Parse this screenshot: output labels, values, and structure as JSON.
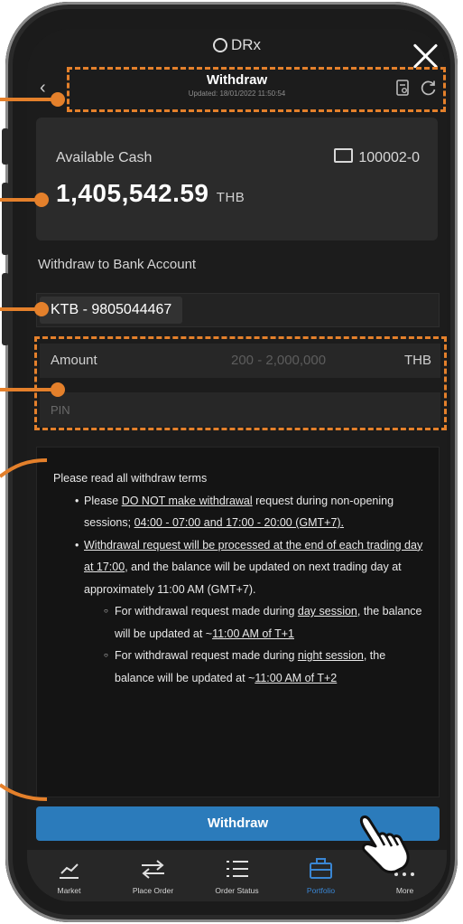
{
  "app": {
    "brand": "DRx"
  },
  "header": {
    "back_icon": "chevron-left-icon",
    "title": "Withdraw",
    "updated": "Updated: 18/01/2022 11:50:54",
    "icons": [
      "report-icon",
      "refresh-icon"
    ]
  },
  "cash": {
    "label": "Available Cash",
    "account": "100002-0",
    "amount": "1,405,542.59",
    "currency": "THB"
  },
  "bank": {
    "section_label": "Withdraw to Bank Account",
    "account": "KTB - 9805044467"
  },
  "form": {
    "amount_label": "Amount",
    "amount_placeholder": "200 - 2,000,000",
    "amount_currency": "THB",
    "pin_placeholder": "PIN"
  },
  "terms": {
    "heading": "Please read all withdraw terms",
    "b1_pre": "Please ",
    "b1_u1": "DO NOT make withdrawal",
    "b1_mid": " request during non-opening sessions; ",
    "b1_u2": "04:00 - 07:00 and 17:00 - 20:00 (GMT+7).",
    "b2_u": "Withdrawal request will be processed at the end of each trading day at 17:00",
    "b2_rest": ", and the balance will be updated on next trading day at approximately 11:00 AM (GMT+7).",
    "s1_pre": "For withdrawal request made during ",
    "s1_u1": "day session",
    "s1_mid": ", the balance will be updated at ~",
    "s1_u2": "11:00 AM of T+1",
    "s2_pre": "For withdrawal request made during ",
    "s2_u1": "night session",
    "s2_mid": ", the balance will be updated at ~",
    "s2_u2": "11:00 AM of T+2"
  },
  "action": {
    "withdraw_label": "Withdraw"
  },
  "nav": {
    "items": [
      {
        "label": "Market",
        "icon": "chart-line-icon"
      },
      {
        "label": "Place Order",
        "icon": "swap-arrows-icon"
      },
      {
        "label": "Order Status",
        "icon": "list-icon"
      },
      {
        "label": "Portfolio",
        "icon": "briefcase-icon"
      },
      {
        "label": "More",
        "icon": "more-dots-icon"
      }
    ],
    "active": "Portfolio"
  },
  "colors": {
    "accent": "#2b7bbb",
    "highlight": "#e4802b",
    "nav_active": "#3a86d3"
  }
}
